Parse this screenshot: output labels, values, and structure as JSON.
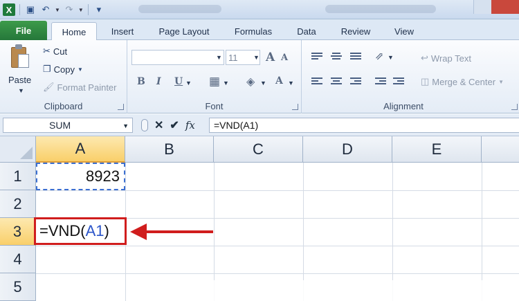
{
  "qat": {
    "icons": [
      "excel-logo",
      "save-icon",
      "undo-icon",
      "redo-icon",
      "customize-icon"
    ]
  },
  "tabs": [
    {
      "label": "File"
    },
    {
      "label": "Home"
    },
    {
      "label": "Insert"
    },
    {
      "label": "Page Layout"
    },
    {
      "label": "Formulas"
    },
    {
      "label": "Data"
    },
    {
      "label": "Review"
    },
    {
      "label": "View"
    }
  ],
  "ribbon": {
    "clipboard": {
      "label": "Clipboard",
      "paste": "Paste",
      "cut": "Cut",
      "copy": "Copy",
      "format_painter": "Format Painter"
    },
    "font": {
      "label": "Font",
      "font_name": "",
      "font_size": "11",
      "grow": "A",
      "shrink": "A",
      "bold": "B",
      "italic": "I",
      "underline": "U",
      "font_color": "A"
    },
    "alignment": {
      "label": "Alignment",
      "wrap_text": "Wrap Text",
      "merge_center": "Merge & Center"
    }
  },
  "formula_bar": {
    "name_box": "SUM",
    "cancel": "✕",
    "enter": "✔",
    "fx": "fx",
    "formula": "=VND(A1)"
  },
  "sheet": {
    "columns": [
      "A",
      "B",
      "C",
      "D",
      "E"
    ],
    "rows": [
      "1",
      "2",
      "3",
      "4",
      "5"
    ],
    "selected_column": "A",
    "selected_row": "3",
    "cells": {
      "A1": "8923",
      "A3_prefix": "=VND(",
      "A3_ref": "A1",
      "A3_suffix": ")"
    }
  },
  "colors": {
    "accent": "#1f7a3c",
    "highlight_border": "#d01d1d",
    "reference_blue": "#2b55c9",
    "header_selected": "#f9cf6a"
  }
}
